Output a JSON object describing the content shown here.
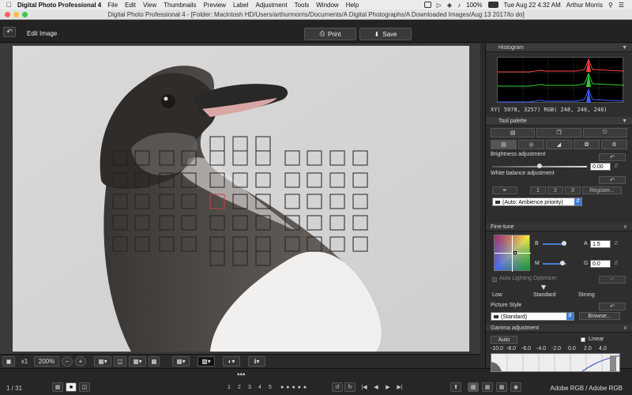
{
  "menubar": {
    "app_name": "Digital Photo Professional 4",
    "menus": [
      "File",
      "Edit",
      "View",
      "Thumbnails",
      "Preview",
      "Label",
      "Adjustment",
      "Tools",
      "Window",
      "Help"
    ],
    "battery": "100%",
    "datetime": "Tue Aug 22  4:32 AM",
    "user": "Arthur Morris"
  },
  "window": {
    "title": "Digital Photo Professional 4 - [Folder: Macintosh HD/Users/arthurmorris/Documents/A Digital Photographs/A Downloaded Images/Aug 13 2017/to do]"
  },
  "toolbar": {
    "mode_label": "Edit Image",
    "print_label": "Print",
    "save_label": "Save"
  },
  "viewbar": {
    "fit_label": "x1",
    "zoom_value": "200%"
  },
  "statusbar": {
    "page_counter": "1 / 31",
    "ratings": [
      "1",
      "2",
      "3",
      "4",
      "5"
    ],
    "color_space": "Adobe RGB / Adobe RGB"
  },
  "histogram": {
    "title": "Histogram",
    "readout": "XY(  5078,  3257) RGB( 248, 246, 248)"
  },
  "tool_palette": {
    "title": "Tool palette",
    "brightness": {
      "label": "Brightness adjustment",
      "value": "0.00",
      "level": 0.5
    },
    "white_balance": {
      "label": "White balance adjustment",
      "presets": [
        "1",
        "2",
        "3"
      ],
      "register_label": "Register...",
      "mode": "(Auto: Ambience priority)"
    }
  },
  "fine_tune": {
    "title": "Fine-tune",
    "b_label": "B",
    "a_label": "A",
    "a_value": "1.5",
    "m_label": "M",
    "g_label": "G",
    "g_value": "0.0",
    "alo_label": "Auto Lighting Optimizer",
    "alo_levels": [
      "Low",
      "Standard",
      "Strong"
    ],
    "picture_style_label": "Picture Style",
    "picture_style_value": "(Standard)",
    "browse_label": "Browse..."
  },
  "gamma": {
    "title": "Gamma adjustment",
    "auto_label": "Auto",
    "linear_label": "Linear",
    "scale": [
      "-10.0",
      "-8.0",
      "-6.0",
      "-4.0",
      "-2.0",
      "0.0",
      "2.0",
      "4.0"
    ]
  },
  "colors": {
    "accent": "#3b7ed8",
    "panel_bg": "#2e2e2e",
    "af_active": "#c84040"
  }
}
